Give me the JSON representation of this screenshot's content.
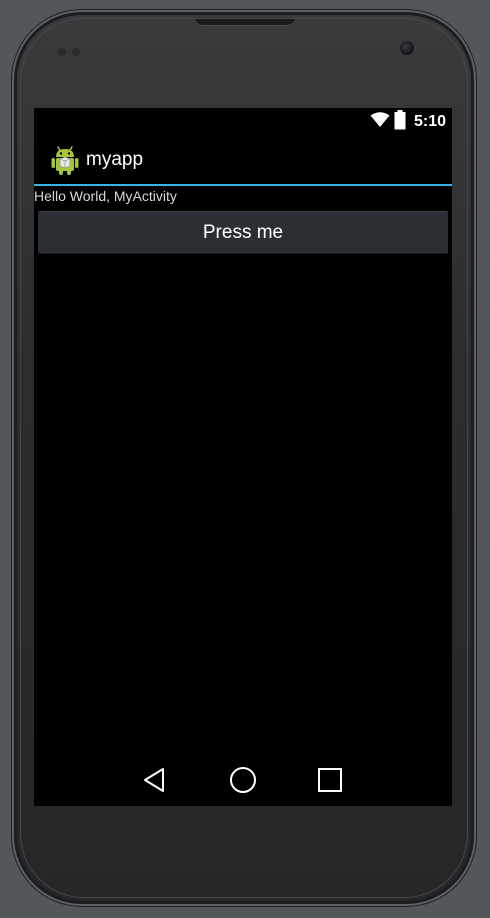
{
  "status_bar": {
    "time": "5:10",
    "icons": [
      "wifi-icon",
      "battery-icon"
    ]
  },
  "action_bar": {
    "app_icon": "android-icon",
    "title": "myapp"
  },
  "content": {
    "hello_text": "Hello World, MyActivity",
    "button_label": "Press me"
  },
  "nav_bar": {
    "buttons": [
      "back",
      "home",
      "recents"
    ]
  },
  "colors": {
    "accent": "#33b5e5",
    "android_green": "#a4c639",
    "background": "#000000",
    "button": "#2b2f33"
  }
}
